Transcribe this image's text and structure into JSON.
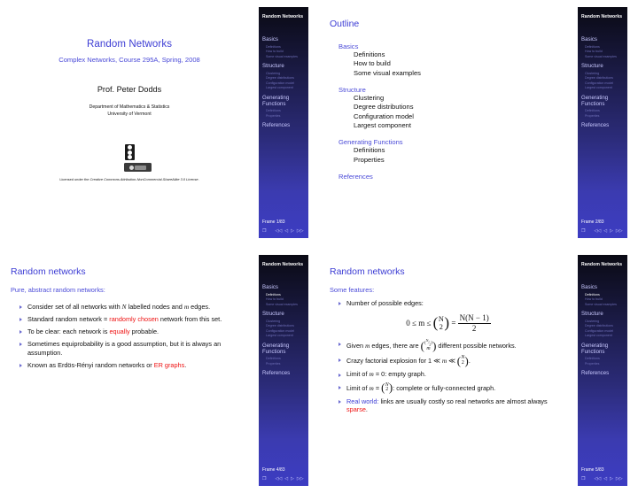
{
  "deck": {
    "sidebar_title": "Random Networks",
    "nav": [
      {
        "section": "Basics",
        "items": [
          "Definitions",
          "How to build",
          "Some visual examples"
        ]
      },
      {
        "section": "Structure",
        "items": [
          "Clustering",
          "Degree distributions",
          "Configuration model",
          "Largest component"
        ]
      },
      {
        "section": "Generating Functions",
        "items": [
          "Definitions",
          "Properties"
        ]
      },
      {
        "section": "References",
        "items": []
      }
    ],
    "nav_sec_generating_line1": "Generating",
    "nav_sec_generating_line2": "Functions",
    "nav_icons": {
      "book": "❐",
      "first": "◁◁",
      "prev": "◁",
      "next": "▷",
      "last": "▷▷"
    }
  },
  "slide1": {
    "frame": "Frame 1/83",
    "title": "Random Networks",
    "subtitle": "Complex Networks, Course 295A, Spring, 2008",
    "author": "Prof. Peter Dodds",
    "dept_line1": "Department of Mathematics & Statistics",
    "dept_line2": "University of Vermont",
    "license_prefix": "Licensed under the ",
    "license_name": "Creative Commons Attribution-NonCommercial-ShareAlike 3.0 License",
    "license_suffix": ".",
    "logo_name": "uvm-logo",
    "cc_badge_name": "creative-commons-badge"
  },
  "slide2": {
    "frame": "Frame 2/83",
    "title": "Outline",
    "sections": [
      {
        "name": "Basics",
        "items": [
          "Definitions",
          "How to build",
          "Some visual examples"
        ]
      },
      {
        "name": "Structure",
        "items": [
          "Clustering",
          "Degree distributions",
          "Configuration model",
          "Largest component"
        ]
      },
      {
        "name": "Generating Functions",
        "items": [
          "Definitions",
          "Properties"
        ]
      },
      {
        "name": "References",
        "items": []
      }
    ]
  },
  "slide4": {
    "frame": "Frame 4/83",
    "title": "Random networks",
    "lead": "Pure, abstract random networks:",
    "bullets": [
      {
        "pre": "Consider set of all networks with ",
        "m1": "N",
        "mid": " labelled nodes and ",
        "m2": "m",
        "post": " edges."
      },
      {
        "pre": "Standard random network = ",
        "hl": "randomly chosen",
        "post": " network from this set."
      },
      {
        "pre": "To be clear: each network is ",
        "hl": "equally",
        "post": " probable."
      },
      {
        "pre": "Sometimes equiprobability is a good assumption, but it is always an assumption.",
        "hl": "",
        "post": ""
      },
      {
        "pre": "Known as Erdös-Rényi random networks or ",
        "hl": "ER graphs",
        "post": "."
      }
    ],
    "active_nav": "Definitions"
  },
  "slide5": {
    "frame": "Frame 5/83",
    "title": "Random networks",
    "lead": "Some features:",
    "b1": "Number of possible edges:",
    "equation": {
      "lhs": "0 ≤ m ≤",
      "binom_top": "N",
      "binom_bottom": "2",
      "eq": "=",
      "frac_num": "N(N − 1)",
      "frac_den": "2",
      "plain": "0 ≤ m ≤ (N choose 2) = N(N−1)/2"
    },
    "b2_pre": "Given ",
    "b2_m": "m",
    "b2_mid": " edges, there are ",
    "b2_post": " different possible networks.",
    "b2_binom_top": "(N choose 2)",
    "b2_binom_bottom": "m",
    "b3_pre": "Crazy factorial explosion for 1 ≪ ",
    "b3_m": "m",
    "b3_mid": " ≪ ",
    "b3_post": ".",
    "b4_pre": "Limit of ",
    "b4_m": "m",
    "b4_post": " = 0: empty graph.",
    "b5_pre": "Limit of ",
    "b5_m": "m",
    "b5_mid": " = ",
    "b5_post": ": complete or fully-connected graph.",
    "b6_hl": "Real world:",
    "b6_mid": " links are usually costly so real networks are almost always ",
    "b6_hl2": "sparse",
    "b6_post": ".",
    "active_nav": "Definitions"
  },
  "colors": {
    "accent_blue": "#3c3cd4",
    "link_blue": "#4b4bd8",
    "highlight_red": "#ee1111",
    "sidebar_top": "#0a0a14",
    "sidebar_bottom": "#3c3cc2",
    "text": "#111111"
  }
}
